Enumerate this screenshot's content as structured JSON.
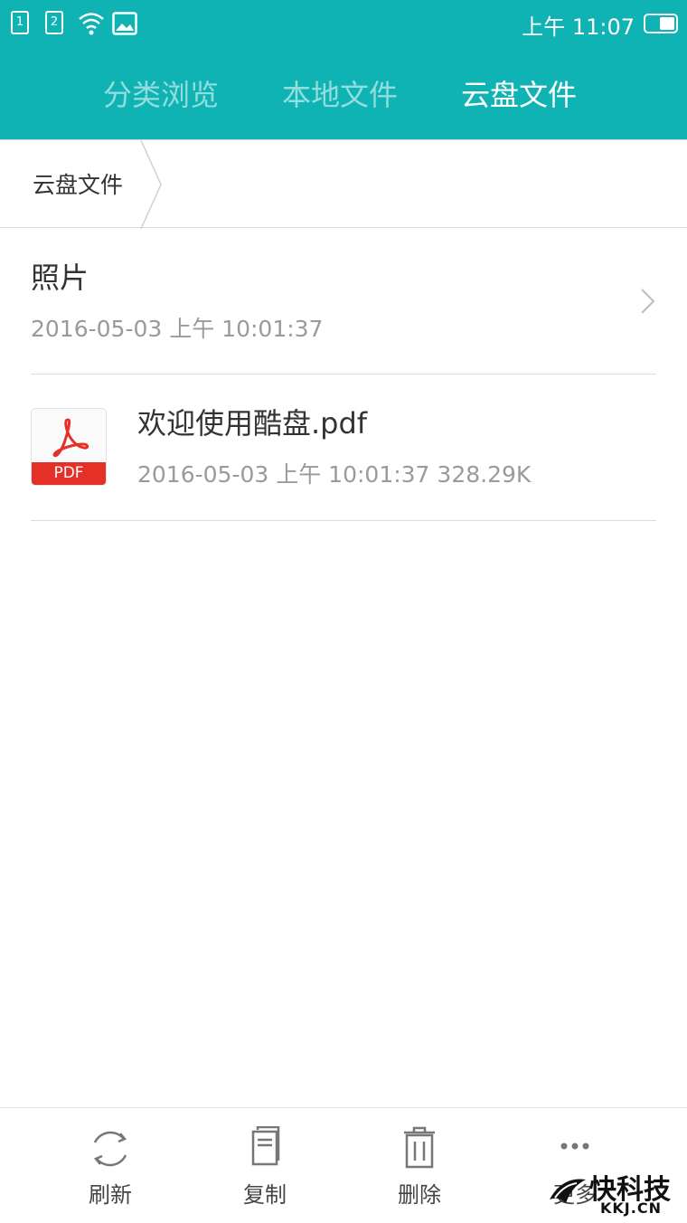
{
  "status_bar": {
    "sim1": "1",
    "sim2": "2",
    "time": "上午 11:07"
  },
  "header": {
    "tabs": [
      {
        "label": "分类浏览",
        "active": false
      },
      {
        "label": "本地文件",
        "active": false
      },
      {
        "label": "云盘文件",
        "active": true
      }
    ],
    "color": "#0fb3b3"
  },
  "breadcrumb": {
    "items": [
      "云盘文件"
    ]
  },
  "files": [
    {
      "name": "照片",
      "meta": "2016-05-03 上午 10:01:37",
      "type": "folder",
      "icon": "chevron-right-icon"
    },
    {
      "name": "欢迎使用酷盘.pdf",
      "meta": "2016-05-03 上午 10:01:37 328.29K",
      "type": "pdf",
      "icon_label": "PDF",
      "icon": "pdf-file-icon"
    }
  ],
  "actions": [
    {
      "label": "刷新",
      "icon": "refresh-icon"
    },
    {
      "label": "复制",
      "icon": "copy-icon"
    },
    {
      "label": "删除",
      "icon": "trash-icon"
    },
    {
      "label": "更多",
      "icon": "more-icon"
    }
  ],
  "watermark": {
    "text": "快科技",
    "sub": "KKJ.CN"
  }
}
